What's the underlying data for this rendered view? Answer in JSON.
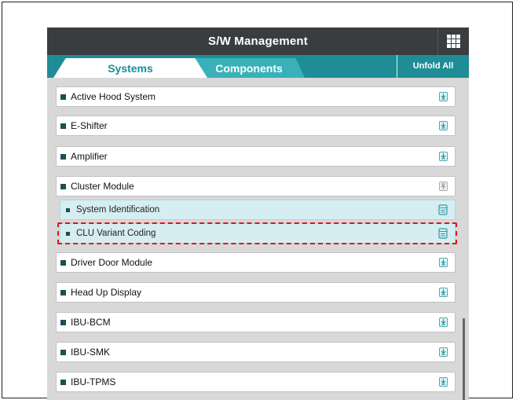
{
  "header": {
    "title": "S/W Management",
    "menu_icon": "grid-menu-icon"
  },
  "tabs": [
    {
      "label": "Systems",
      "active": true
    },
    {
      "label": "Components",
      "active": false
    }
  ],
  "unfold_label": "Unfold All",
  "systems": [
    {
      "label": "Active Hood System",
      "icon": "download-icon"
    },
    {
      "label": "E-Shifter",
      "icon": "download-icon"
    },
    {
      "label": "Amplifier",
      "icon": "download-icon"
    },
    {
      "label": "Cluster Module",
      "icon": "collapse-icon",
      "expanded": true
    },
    {
      "label": "Driver Door Module",
      "icon": "download-icon"
    },
    {
      "label": "Head Up Display",
      "icon": "download-icon"
    },
    {
      "label": "IBU-BCM",
      "icon": "download-icon"
    },
    {
      "label": "IBU-SMK",
      "icon": "download-icon"
    },
    {
      "label": "IBU-TPMS",
      "icon": "download-icon"
    }
  ],
  "cluster_sub_items": [
    {
      "label": "System Identification",
      "icon": "document-icon"
    },
    {
      "label": "CLU Variant Coding",
      "icon": "document-icon",
      "highlighted": true
    }
  ],
  "colors": {
    "header_bg": "#3a3d40",
    "tab_bar": "#1e8d96",
    "tab_inactive": "#38b1b9",
    "active_tab_text": "#1a8e99",
    "highlight": "#e0141b"
  }
}
